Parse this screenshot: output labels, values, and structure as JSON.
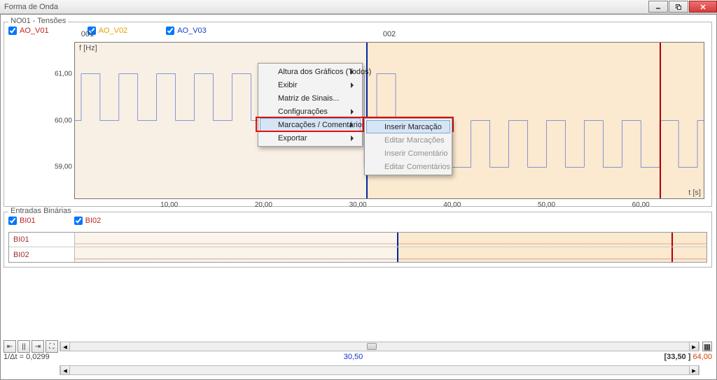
{
  "window": {
    "title": "Forma de Onda"
  },
  "tensoes": {
    "title": "NO01 - Tensões",
    "signals": [
      "AO_V01",
      "AO_V02",
      "AO_V03"
    ],
    "yunit": "f [Hz]",
    "xunit": "t [s]",
    "yticks": [
      "61,00",
      "60,00",
      "59,00"
    ],
    "xticks": [
      "10,00",
      "20,00",
      "30,00",
      "40,00",
      "50,00",
      "60,00"
    ],
    "markers": [
      "001",
      "002"
    ]
  },
  "binarias": {
    "title": "Entradas Binárias",
    "signals": [
      "BI01",
      "BI02"
    ],
    "rows": [
      "BI01",
      "BI02"
    ]
  },
  "context_menu": {
    "items": [
      "Altura dos Gráficos (Todos)",
      "Exibir",
      "Matriz de Sinais...",
      "Configurações",
      "Marcações / Comentários",
      "Exportar"
    ],
    "submenu": [
      "Inserir Marcação",
      "Editar Marcações",
      "Inserir Comentário",
      "Editar Comentários"
    ]
  },
  "bottom": {
    "delta": "1/Δt = 0,0299",
    "center": "30,50",
    "bracket": "[33,50 ]",
    "right": "64,00"
  },
  "chart_data": {
    "type": "line",
    "xlabel": "t [s]",
    "ylabel": "f [Hz]",
    "ylim": [
      58.5,
      61.5
    ],
    "xlim": [
      0,
      66
    ],
    "cursor1_x": 30.5,
    "cursor2_x": 61.3,
    "series": [
      {
        "name": "AO_V03",
        "color": "#1040d0",
        "pattern": "square wave stepping between ≈59.0 and ≈61.0 Hz with ~4 s period over full range; dips to 59.0 near cursor1 and resumes"
      },
      {
        "name": "AO_V02",
        "color": "#e2a200",
        "pattern": "overlaid, not distinctly visible"
      },
      {
        "name": "AO_V01",
        "color": "#c02020",
        "pattern": "overlaid, not distinctly visible"
      }
    ],
    "binary_series": [
      {
        "name": "BI01",
        "value": "constant low over full range"
      },
      {
        "name": "BI02",
        "value": "constant low over full range"
      }
    ]
  }
}
